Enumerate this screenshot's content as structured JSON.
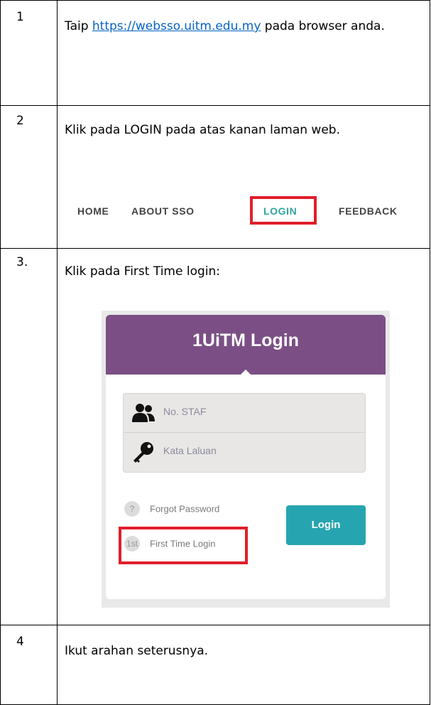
{
  "steps": [
    {
      "num": "1",
      "text_before": "Taip ",
      "link": "https://websso.uitm.edu.my",
      "text_after": " pada browser anda."
    },
    {
      "num": "2",
      "text": "Klik pada LOGIN pada atas kanan laman web."
    },
    {
      "num": "3.",
      "text": "Klik pada First Time login:"
    },
    {
      "num": "4",
      "text": "Ikut arahan seterusnya."
    }
  ],
  "nav": {
    "home": "HOME",
    "about": "ABOUT SSO",
    "login": "LOGIN",
    "feedback": "FEEDBACK"
  },
  "login_panel": {
    "title": "1UiTM Login",
    "staff_placeholder": "No. STAF",
    "password_placeholder": "Kata Laluan",
    "forgot_badge": "?",
    "forgot_label": "Forgot Password",
    "first_badge": "1st",
    "first_label": "First Time Login",
    "login_button": "Login"
  },
  "colors": {
    "header_purple": "#7b4f85",
    "button_teal": "#26a5b0",
    "highlight_red": "#e01e2b",
    "link_blue": "#0563c1",
    "nav_active": "#2fa59f"
  }
}
